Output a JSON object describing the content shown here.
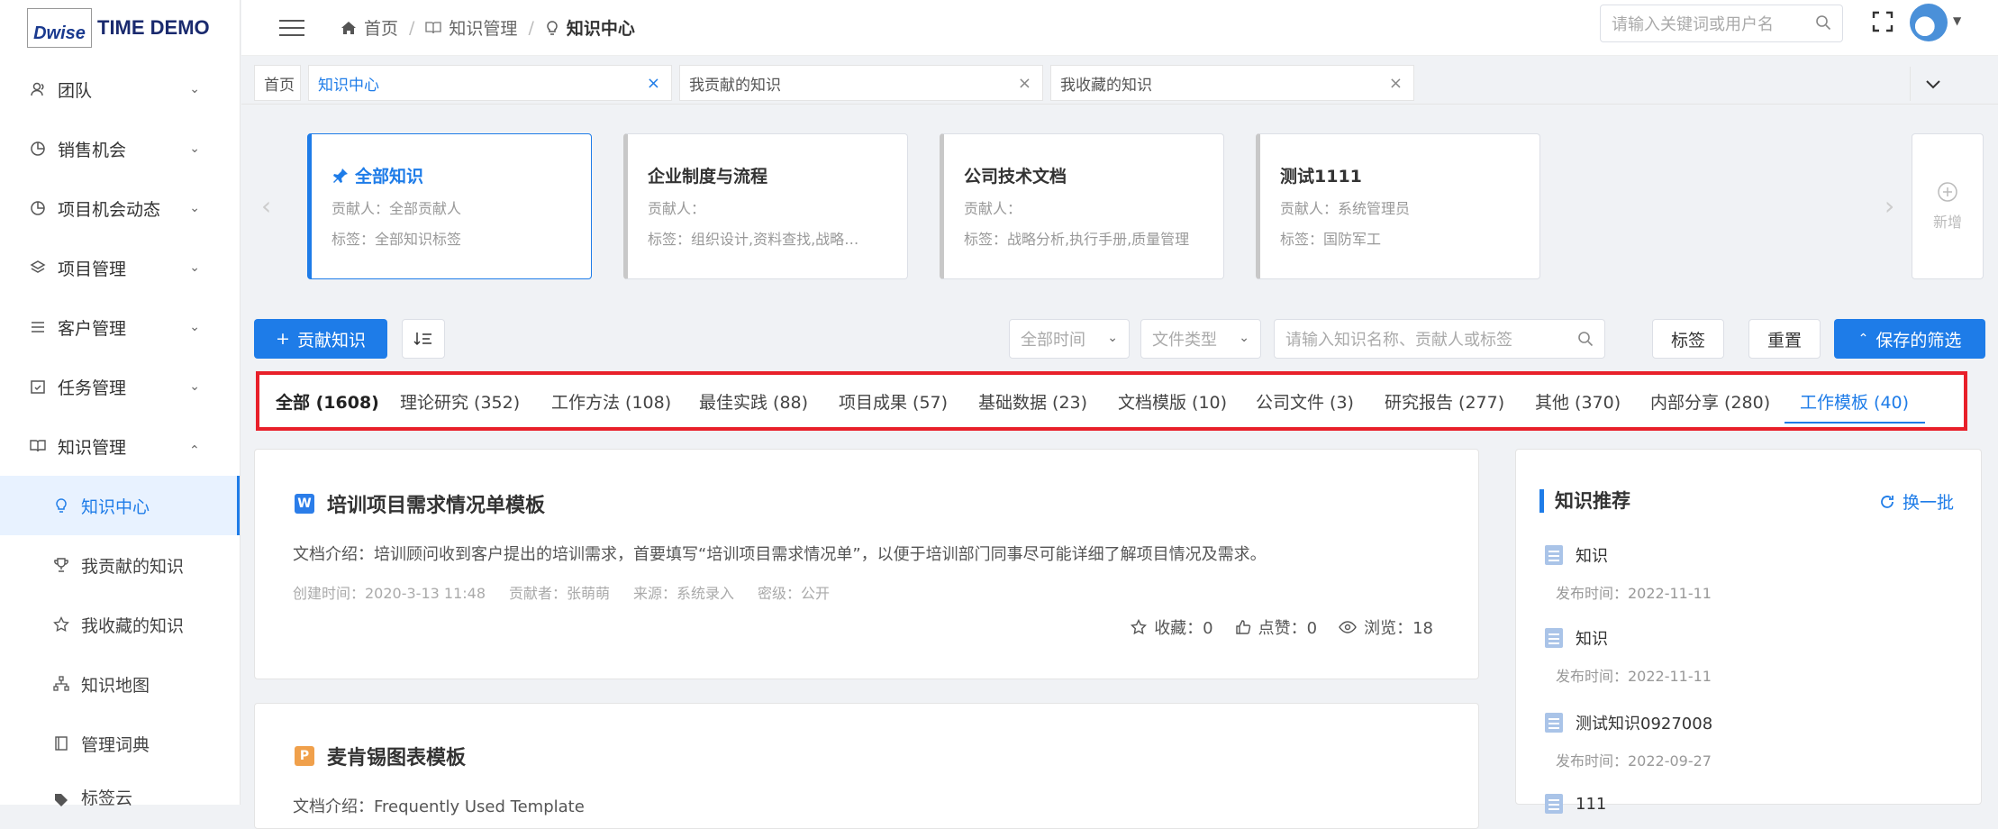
{
  "logo": {
    "brand": "Dwise",
    "title": "TIME DEMO"
  },
  "sidebar": {
    "items": [
      {
        "label": "团队"
      },
      {
        "label": "销售机会"
      },
      {
        "label": "项目机会动态"
      },
      {
        "label": "项目管理"
      },
      {
        "label": "客户管理"
      },
      {
        "label": "任务管理"
      },
      {
        "label": "知识管理"
      }
    ],
    "subitems": [
      {
        "label": "知识中心"
      },
      {
        "label": "我贡献的知识"
      },
      {
        "label": "我收藏的知识"
      },
      {
        "label": "知识地图"
      },
      {
        "label": "管理词典"
      },
      {
        "label": "标签云"
      }
    ]
  },
  "header": {
    "breadcrumb": [
      "首页",
      "知识管理",
      "知识中心"
    ],
    "search_placeholder": "请输入关键词或用户名"
  },
  "tabs": [
    {
      "label": "首页"
    },
    {
      "label": "知识中心"
    },
    {
      "label": "我贡献的知识"
    },
    {
      "label": "我收藏的知识"
    }
  ],
  "categories": [
    {
      "title": "全部知识",
      "contributor": "贡献人：全部贡献人",
      "tags": "标签：全部知识标签"
    },
    {
      "title": "企业制度与流程",
      "contributor": "贡献人：",
      "tags": "标签：组织设计,资料查找,战略执行,行业分析"
    },
    {
      "title": "公司技术文档",
      "contributor": "贡献人：",
      "tags": "标签：战略分析,执行手册,质量管理"
    },
    {
      "title": "测试1111",
      "contributor": "贡献人：系统管理员",
      "tags": "标签：国防军工"
    }
  ],
  "add_card_label": "新增",
  "toolbar": {
    "contribute": "贡献知识",
    "time_select": "全部时间",
    "type_select": "文件类型",
    "search_placeholder": "请输入知识名称、贡献人或标签",
    "tag_button": "标签",
    "reset_button": "重置",
    "saved_filter": "保存的筛选"
  },
  "filter_tabs": [
    "全部 (1608)",
    "理论研究 (352)",
    "工作方法 (108)",
    "最佳实践 (88)",
    "项目成果 (57)",
    "基础数据 (23)",
    "文档模版 (10)",
    "公司文件 (3)",
    "研究报告 (277)",
    "其他 (370)",
    "内部分享 (280)",
    "工作模板 (40)"
  ],
  "documents": [
    {
      "badge": "W",
      "badge_color": "#2b7de9",
      "title": "培训项目需求情况单模板",
      "intro": "文档介绍：培训顾问收到客户提出的培训需求，首要填写“培训项目需求情况单”，以便于培训部门同事尽可能详细了解项目情况及需求。",
      "created": "创建时间：2020-3-13 11:48",
      "contributor": "贡献者：张萌萌",
      "source": "来源：系统录入",
      "secret": "密级：公开",
      "fav": "收藏：0",
      "like": "点赞：0",
      "view": "浏览：18"
    },
    {
      "badge": "P",
      "badge_color": "#f0a04b",
      "title": "麦肯锡图表模板",
      "intro": "文档介绍：Frequently Used Template"
    }
  ],
  "recommend": {
    "title": "知识推荐",
    "refresh": "换一批",
    "items": [
      {
        "name": "知识",
        "date": "发布时间：2022-11-11"
      },
      {
        "name": "知识",
        "date": "发布时间：2022-11-11"
      },
      {
        "name": "测试知识0927008",
        "date": "发布时间：2022-09-27"
      },
      {
        "name": "111",
        "date": ""
      }
    ]
  },
  "colors": {
    "primary": "#1e7ce8",
    "highlight_border": "#e8202a"
  }
}
